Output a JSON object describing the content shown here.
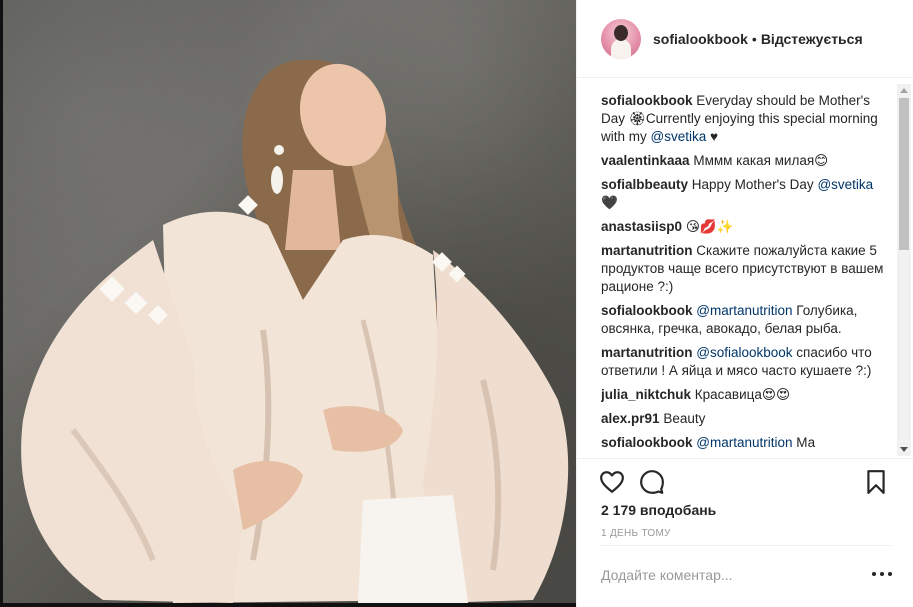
{
  "header": {
    "username": "sofialookbook",
    "separator": "•",
    "follow_status": "Відстежується"
  },
  "comments": [
    {
      "user": "sofialookbook",
      "text": "Everyday should be Mother's Day 🏵Currently enjoying this special morning with my ",
      "mention": "@svetika",
      "text_after": " ♥"
    },
    {
      "user": "vaalentinkaaa",
      "text": "Мммм какая милая😊",
      "mention": "",
      "text_after": ""
    },
    {
      "user": "sofialbbeauty",
      "text": "Happy Mother's Day ",
      "mention": "@svetika",
      "text_after": " 🖤"
    },
    {
      "user": "anastasiisp0",
      "text": "😘💋✨",
      "mention": "",
      "text_after": ""
    },
    {
      "user": "martanutrition",
      "text": "Скажите пожалуйста какие 5 продуктов чаще всего присутствуют в вашем рационе ?:)",
      "mention": "",
      "text_after": ""
    },
    {
      "user": "sofialookbook",
      "text": "",
      "mention": "@martanutrition",
      "text_after": " Голубика, овсянка, гречка, авокадо, белая рыба."
    },
    {
      "user": "martanutrition",
      "text": "",
      "mention": "@sofialookbook",
      "text_after": " спасибо что ответили ! А яйца и мясо часто кушаете ?:)"
    },
    {
      "user": "julia_niktchuk",
      "text": "Красавица😍😍",
      "mention": "",
      "text_after": ""
    },
    {
      "user": "alex.pr91",
      "text": "Beauty",
      "mention": "",
      "text_after": ""
    },
    {
      "user": "sofialookbook",
      "text": "",
      "mention": "@martanutrition",
      "text_after": " Ма"
    }
  ],
  "actions": {
    "like_icon": "heart-icon",
    "comment_icon": "comment-bubble-icon",
    "save_icon": "bookmark-icon"
  },
  "likes_text": "2 179 вподобань",
  "time_text": "1 ДЕНЬ ТОМУ",
  "add_comment": {
    "placeholder": "Додайте коментар...",
    "value": ""
  },
  "more_icon": "more-options-icon"
}
